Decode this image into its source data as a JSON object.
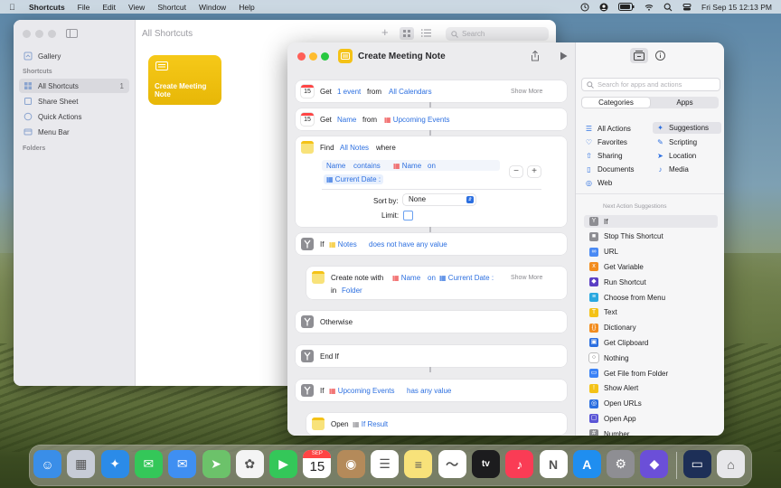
{
  "menubar": {
    "app": "Shortcuts",
    "items": [
      "File",
      "Edit",
      "View",
      "Shortcut",
      "Window",
      "Help"
    ],
    "clock": "Fri Sep 15  12:13 PM"
  },
  "library_window": {
    "title": "All Shortcuts",
    "search_placeholder": "Search",
    "sidebar": {
      "gallery": "Gallery",
      "shortcuts_header": "Shortcuts",
      "items": [
        {
          "label": "All Shortcuts",
          "count": "1"
        },
        {
          "label": "Share Sheet"
        },
        {
          "label": "Quick Actions"
        },
        {
          "label": "Menu Bar"
        }
      ],
      "folders_header": "Folders"
    },
    "tile": {
      "label": "Create Meeting Note",
      "color": "#f4c217"
    }
  },
  "editor": {
    "title": "Create Meeting Note",
    "actions": {
      "get_events": {
        "verb": "Get",
        "count": "1 event",
        "from": "from",
        "source": "All Calendars",
        "more": "Show More",
        "date_badge": "15"
      },
      "get_name": {
        "verb": "Get",
        "prop": "Name",
        "from": "from",
        "source": "Upcoming Events",
        "date_badge": "15"
      },
      "find": {
        "verb": "Find",
        "target": "All Notes",
        "where": "where",
        "filter_field": "Name",
        "filter_op": "contains",
        "filter_v1": "Name",
        "filter_on": "on",
        "filter_v2": "Current Date",
        "sort_label": "Sort by:",
        "sort_value": "None",
        "limit_label": "Limit:"
      },
      "if1": {
        "verb": "If",
        "var": "Notes",
        "cond": "does not have any value"
      },
      "create_note": {
        "verb": "Create note with",
        "v1": "Name",
        "on": "on",
        "v2": "Current Date",
        "in": "in",
        "folder": "Folder",
        "more": "Show More"
      },
      "otherwise": {
        "label": "Otherwise"
      },
      "end_if": {
        "label": "End If"
      },
      "if2": {
        "verb": "If",
        "var": "Upcoming Events",
        "cond": "has any value"
      },
      "open": {
        "verb": "Open",
        "var": "If Result"
      }
    }
  },
  "panel": {
    "search_placeholder": "Search for apps and actions",
    "tabs": {
      "categories": "Categories",
      "apps": "Apps"
    },
    "categories_left": [
      "All Actions",
      "Favorites",
      "Sharing",
      "Documents",
      "Web"
    ],
    "categories_right": [
      "Suggestions",
      "Scripting",
      "Location",
      "Media"
    ],
    "suggestions_header": "Next Action Suggestions",
    "suggestions": [
      {
        "label": "If",
        "color": "#8e8e93"
      },
      {
        "label": "Stop This Shortcut",
        "color": "#8e8e93"
      },
      {
        "label": "URL",
        "color": "#4a8af4"
      },
      {
        "label": "Get Variable",
        "color": "#f28c1e"
      },
      {
        "label": "Run Shortcut",
        "color": "#5b3fc4"
      },
      {
        "label": "Choose from Menu",
        "color": "#2aa8e0"
      },
      {
        "label": "Text",
        "color": "#f4c217"
      },
      {
        "label": "Dictionary",
        "color": "#f28c1e"
      },
      {
        "label": "Get Clipboard",
        "color": "#2c6fe0"
      },
      {
        "label": "Nothing",
        "color": "#ffffff"
      },
      {
        "label": "Get File from Folder",
        "color": "#3b82f6"
      },
      {
        "label": "Show Alert",
        "color": "#f4c217"
      },
      {
        "label": "Open URLs",
        "color": "#2c6fe0"
      },
      {
        "label": "Open App",
        "color": "#5a55d6"
      },
      {
        "label": "Number",
        "color": "#8e8e93"
      }
    ]
  },
  "dock": {
    "calendar": {
      "month": "SEP",
      "day": "15"
    },
    "apps": [
      {
        "name": "finder",
        "color": "#3a8ee8"
      },
      {
        "name": "launchpad",
        "color": "#c7ccd6"
      },
      {
        "name": "safari",
        "color": "#2b8be8"
      },
      {
        "name": "messages",
        "color": "#34c759"
      },
      {
        "name": "mail",
        "color": "#3f8ff2"
      },
      {
        "name": "maps",
        "color": "#6cc26a"
      },
      {
        "name": "photos",
        "color": "#f4f4f4"
      },
      {
        "name": "facetime",
        "color": "#34c759"
      },
      {
        "name": "calendar",
        "color": "#ffffff"
      },
      {
        "name": "contacts",
        "color": "#b48a5a"
      },
      {
        "name": "reminders",
        "color": "#ffffff"
      },
      {
        "name": "notes",
        "color": "#f8e27a"
      },
      {
        "name": "freeform",
        "color": "#ffffff"
      },
      {
        "name": "tv",
        "color": "#1c1c1e"
      },
      {
        "name": "music",
        "color": "#fa3c55"
      },
      {
        "name": "news",
        "color": "#ffffff"
      },
      {
        "name": "app-store",
        "color": "#1f8ef0"
      },
      {
        "name": "system-settings",
        "color": "#8e8e93"
      },
      {
        "name": "shortcuts",
        "color": "#6b4fd8"
      },
      {
        "name": "desktop-folder",
        "color": "#1d2f57"
      },
      {
        "name": "trash",
        "color": "#e7e7ea"
      }
    ]
  }
}
